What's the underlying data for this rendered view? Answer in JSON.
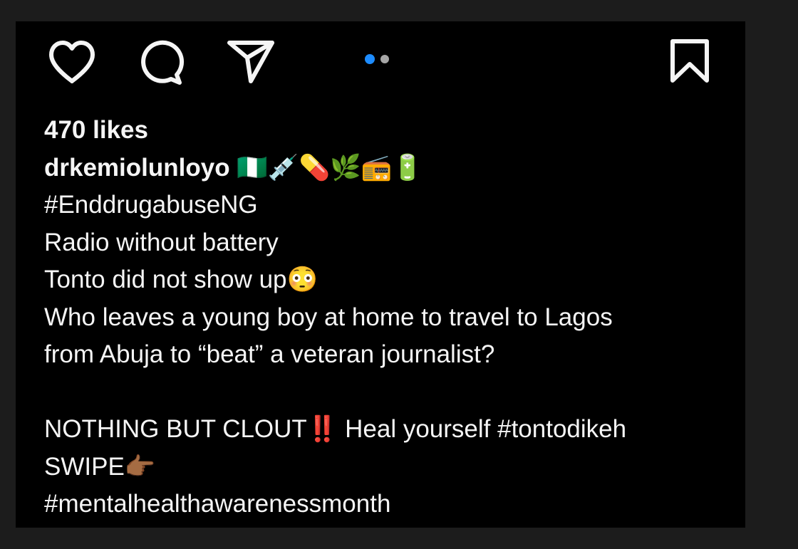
{
  "actions": {
    "like_icon": "heart-outline",
    "comment_icon": "speech-bubble-outline",
    "share_icon": "paper-plane-outline",
    "save_icon": "bookmark-outline",
    "carousel": {
      "count": 2,
      "active_index": 0,
      "active_color": "#1d8cff",
      "inactive_color": "#a6a6a6"
    }
  },
  "post": {
    "likes": "470 likes",
    "username": "drkemiolunloyo",
    "username_emojis": "🇳🇬💉💊🌿📻🔋",
    "caption": [
      "#EnddrugabuseNG",
      "Radio without battery",
      "Tonto did not show up😳",
      "Who leaves a young boy at home to travel to Lagos",
      "from Abuja to “beat” a veteran journalist?",
      "",
      "NOTHING BUT CLOUT‼️ Heal yourself #tontodikeh",
      "SWIPE👉🏾",
      "#mentalhealthawarenessmonth"
    ]
  },
  "colors": {
    "background": "#1c1c1c",
    "post_background": "#000000",
    "text": "#f5f5f5"
  }
}
